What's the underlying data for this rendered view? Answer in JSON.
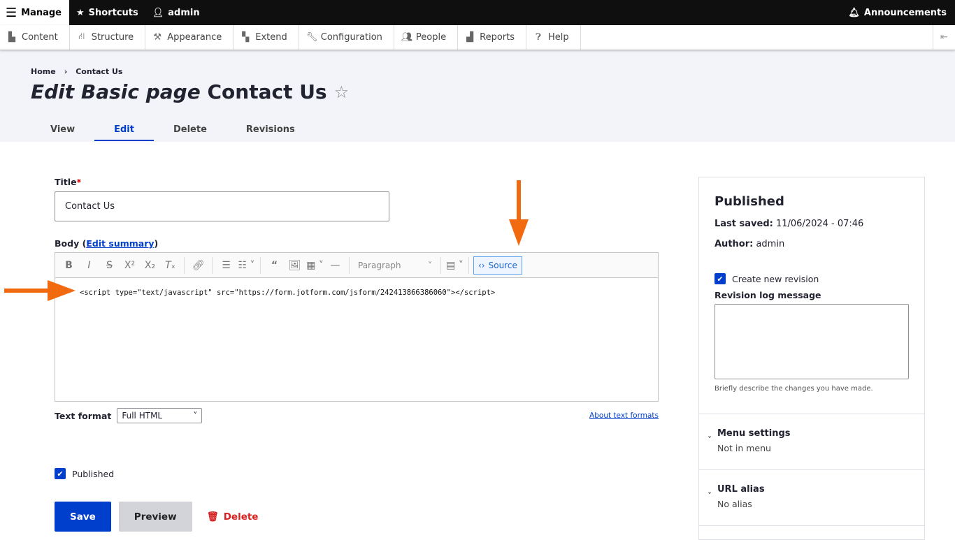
{
  "toolbar": {
    "manage": "Manage",
    "shortcuts": "Shortcuts",
    "user": "admin",
    "announcements": "Announcements"
  },
  "tray": [
    "Content",
    "Structure",
    "Appearance",
    "Extend",
    "Configuration",
    "People",
    "Reports",
    "Help"
  ],
  "breadcrumb": {
    "home": "Home",
    "current": "Contact Us"
  },
  "page_title": {
    "prefix": "Edit Basic page",
    "name": "Contact Us"
  },
  "tabs": [
    "View",
    "Edit",
    "Delete",
    "Revisions"
  ],
  "form": {
    "title_label": "Title",
    "required": "*",
    "title_value": "Contact Us",
    "body_label": "Body (",
    "edit_summary": "Edit summary",
    "body_label_end": ")",
    "paragraph": "Paragraph",
    "source": "Source",
    "body_code": "<script type=\"text/javascript\" src=\"https://form.jotform.com/jsform/242413866386060\"></script>",
    "text_format_label": "Text format",
    "text_format_value": "Full HTML",
    "about_formats": "About text formats",
    "published": "Published",
    "save": "Save",
    "preview": "Preview",
    "delete": "Delete"
  },
  "sidebar": {
    "status": "Published",
    "last_saved_label": "Last saved:",
    "last_saved": "11/06/2024 - 07:46",
    "author_label": "Author:",
    "author": "admin",
    "create_revision": "Create new revision",
    "revision_log_label": "Revision log message",
    "revision_hint": "Briefly describe the changes you have made.",
    "menu_settings": "Menu settings",
    "menu_value": "Not in menu",
    "url_alias": "URL alias",
    "url_value": "No alias"
  },
  "colors": {
    "accent": "#003ecc",
    "annotation": "#f26a10",
    "danger": "#d72222"
  }
}
